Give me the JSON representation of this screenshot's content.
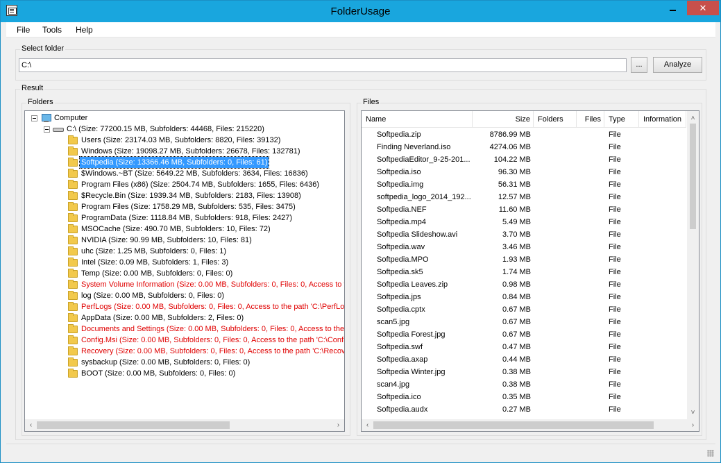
{
  "window": {
    "title": "FolderUsage",
    "close_glyph": "✕"
  },
  "menu": [
    "File",
    "Tools",
    "Help"
  ],
  "select_folder": {
    "label": "Select folder",
    "path_value": "C:\\",
    "browse_label": "...",
    "analyze_label": "Analyze"
  },
  "result": {
    "label": "Result",
    "folders_label": "Folders",
    "files_label": "Files"
  },
  "tree": {
    "computer_label": "Computer",
    "drive_label": "C:\\ (Size: 77200.15 MB, Subfolders: 44468, Files: 215220)",
    "folders": [
      {
        "text": "Users (Size: 23174.03 MB, Subfolders: 8820, Files: 39132)",
        "error": false
      },
      {
        "text": "Windows (Size: 19098.27 MB, Subfolders: 26678, Files: 132781)",
        "error": false
      },
      {
        "text": "Softpedia (Size: 13366.46 MB, Subfolders: 0, Files: 61)",
        "error": false,
        "selected": true
      },
      {
        "text": "$Windows.~BT (Size: 5649.22 MB, Subfolders: 3634, Files: 16836)",
        "error": false
      },
      {
        "text": "Program Files (x86) (Size: 2504.74 MB, Subfolders: 1655, Files: 6436)",
        "error": false
      },
      {
        "text": "$Recycle.Bin (Size: 1939.34 MB, Subfolders: 2183, Files: 13908)",
        "error": false
      },
      {
        "text": "Program Files (Size: 1758.29 MB, Subfolders: 535, Files: 3475)",
        "error": false
      },
      {
        "text": "ProgramData (Size: 1118.84 MB, Subfolders: 918, Files: 2427)",
        "error": false
      },
      {
        "text": "MSOCache (Size: 490.70 MB, Subfolders: 10, Files: 72)",
        "error": false
      },
      {
        "text": "NVIDIA (Size: 90.99 MB, Subfolders: 10, Files: 81)",
        "error": false
      },
      {
        "text": "uhc (Size: 1.25 MB, Subfolders: 0, Files: 1)",
        "error": false
      },
      {
        "text": "Intel (Size: 0.09 MB, Subfolders: 1, Files: 3)",
        "error": false
      },
      {
        "text": "Temp (Size: 0.00 MB, Subfolders: 0, Files: 0)",
        "error": false
      },
      {
        "text": "System Volume Information (Size: 0.00 MB, Subfolders: 0, Files: 0, Access to t",
        "error": true
      },
      {
        "text": "log (Size: 0.00 MB, Subfolders: 0, Files: 0)",
        "error": false
      },
      {
        "text": "PerfLogs (Size: 0.00 MB, Subfolders: 0, Files: 0, Access to the path 'C:\\PerfLo",
        "error": true
      },
      {
        "text": "AppData (Size: 0.00 MB, Subfolders: 2, Files: 0)",
        "error": false
      },
      {
        "text": "Documents and Settings (Size: 0.00 MB, Subfolders: 0, Files: 0, Access to the",
        "error": true
      },
      {
        "text": "Config.Msi (Size: 0.00 MB, Subfolders: 0, Files: 0, Access to the path 'C:\\Confi",
        "error": true
      },
      {
        "text": "Recovery (Size: 0.00 MB, Subfolders: 0, Files: 0, Access to the path 'C:\\Recov",
        "error": true
      },
      {
        "text": "sysbackup (Size: 0.00 MB, Subfolders: 0, Files: 0)",
        "error": false
      },
      {
        "text": "BOOT (Size: 0.00 MB, Subfolders: 0, Files: 0)",
        "error": false
      }
    ]
  },
  "files_list": {
    "columns": [
      "Name",
      "Size",
      "Folders",
      "Files",
      "Type",
      "Information"
    ],
    "rows": [
      {
        "name": "Softpedia.zip",
        "size": "8786.99 MB",
        "type": "File"
      },
      {
        "name": "Finding Neverland.iso",
        "size": "4274.06 MB",
        "type": "File"
      },
      {
        "name": "SoftpediaEditor_9-25-201...",
        "size": "104.22 MB",
        "type": "File"
      },
      {
        "name": "Softpedia.iso",
        "size": "96.30 MB",
        "type": "File"
      },
      {
        "name": "Softpedia.img",
        "size": "56.31 MB",
        "type": "File"
      },
      {
        "name": "softpedia_logo_2014_192...",
        "size": "12.57 MB",
        "type": "File"
      },
      {
        "name": "Softpedia.NEF",
        "size": "11.60 MB",
        "type": "File"
      },
      {
        "name": "Softpedia.mp4",
        "size": "5.49 MB",
        "type": "File"
      },
      {
        "name": "Softpedia Slideshow.avi",
        "size": "3.70 MB",
        "type": "File"
      },
      {
        "name": "Softpedia.wav",
        "size": "3.46 MB",
        "type": "File"
      },
      {
        "name": "Softpedia.MPO",
        "size": "1.93 MB",
        "type": "File"
      },
      {
        "name": "Softpedia.sk5",
        "size": "1.74 MB",
        "type": "File"
      },
      {
        "name": "Softpedia Leaves.zip",
        "size": "0.98 MB",
        "type": "File"
      },
      {
        "name": "Softpedia.jps",
        "size": "0.84 MB",
        "type": "File"
      },
      {
        "name": "Softpedia.cptx",
        "size": "0.67 MB",
        "type": "File"
      },
      {
        "name": "scan5.jpg",
        "size": "0.67 MB",
        "type": "File"
      },
      {
        "name": "Softpedia Forest.jpg",
        "size": "0.67 MB",
        "type": "File"
      },
      {
        "name": "Softpedia.swf",
        "size": "0.47 MB",
        "type": "File"
      },
      {
        "name": "Softpedia.axap",
        "size": "0.44 MB",
        "type": "File"
      },
      {
        "name": "Softpedia Winter.jpg",
        "size": "0.38 MB",
        "type": "File"
      },
      {
        "name": "scan4.jpg",
        "size": "0.38 MB",
        "type": "File"
      },
      {
        "name": "Softpedia.ico",
        "size": "0.35 MB",
        "type": "File"
      },
      {
        "name": "Softpedia.audx",
        "size": "0.27 MB",
        "type": "File"
      }
    ]
  },
  "scroll_glyphs": {
    "left": "‹",
    "right": "›",
    "up": "˄",
    "down": "˅"
  }
}
